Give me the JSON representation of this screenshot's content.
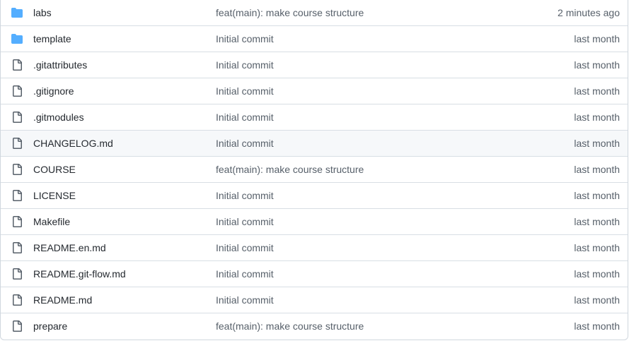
{
  "colors": {
    "folder": "#54aeff",
    "file_icon": "#57606a",
    "text_primary": "#24292f",
    "text_secondary": "#57606a",
    "border": "#d8dee4",
    "hover_row": "#f6f8fa"
  },
  "files": [
    {
      "type": "folder",
      "icon": "folder-icon",
      "name": "labs",
      "message": "feat(main): make course structure",
      "age": "2 minutes ago"
    },
    {
      "type": "folder",
      "icon": "folder-icon",
      "name": "template",
      "message": "Initial commit",
      "age": "last month"
    },
    {
      "type": "file",
      "icon": "file-icon",
      "name": ".gitattributes",
      "message": "Initial commit",
      "age": "last month"
    },
    {
      "type": "file",
      "icon": "file-icon",
      "name": ".gitignore",
      "message": "Initial commit",
      "age": "last month"
    },
    {
      "type": "file",
      "icon": "file-icon",
      "name": ".gitmodules",
      "message": "Initial commit",
      "age": "last month"
    },
    {
      "type": "file",
      "icon": "file-icon",
      "name": "CHANGELOG.md",
      "message": "Initial commit",
      "age": "last month",
      "hovered": true
    },
    {
      "type": "file",
      "icon": "file-icon",
      "name": "COURSE",
      "message": "feat(main): make course structure",
      "age": "last month"
    },
    {
      "type": "file",
      "icon": "file-icon",
      "name": "LICENSE",
      "message": "Initial commit",
      "age": "last month"
    },
    {
      "type": "file",
      "icon": "file-icon",
      "name": "Makefile",
      "message": "Initial commit",
      "age": "last month"
    },
    {
      "type": "file",
      "icon": "file-icon",
      "name": "README.en.md",
      "message": "Initial commit",
      "age": "last month"
    },
    {
      "type": "file",
      "icon": "file-icon",
      "name": "README.git-flow.md",
      "message": "Initial commit",
      "age": "last month"
    },
    {
      "type": "file",
      "icon": "file-icon",
      "name": "README.md",
      "message": "Initial commit",
      "age": "last month"
    },
    {
      "type": "file",
      "icon": "file-icon",
      "name": "prepare",
      "message": "feat(main): make course structure",
      "age": "last month"
    }
  ]
}
